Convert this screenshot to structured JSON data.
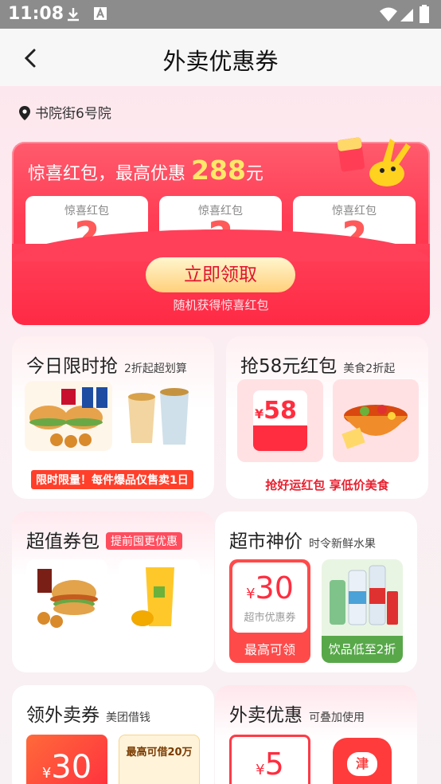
{
  "status_bar": {
    "time": "11:08"
  },
  "header": {
    "title": "外卖优惠券"
  },
  "location": {
    "text": "书院街6号院"
  },
  "red_packet": {
    "prefix": "惊喜红包，最高优惠",
    "amount": "288",
    "unit": "元",
    "cards": [
      {
        "label": "惊喜红包",
        "mark": "?"
      },
      {
        "label": "惊喜红包",
        "mark": "?"
      },
      {
        "label": "惊喜红包",
        "mark": "?"
      }
    ],
    "button": "立即领取",
    "subtext": "随机获得惊喜红包"
  },
  "cards": {
    "flash": {
      "title": "今日限时抢",
      "sub": "2折起超划算",
      "banner": "限时限量！每件爆品仅售卖1日"
    },
    "red58": {
      "title": "抢58元红包",
      "sub": "美食2折起",
      "coupon_symbol": "¥",
      "coupon_value": "58",
      "banner": "抢好运红包 享低价美食"
    },
    "bundle": {
      "title": "超值券包",
      "tag": "提前囤更优惠"
    },
    "market": {
      "title": "超市神价",
      "sub": "时令新鲜水果",
      "coupon_symbol": "¥",
      "coupon_value": "30",
      "coupon_label": "超市优惠券",
      "btn_left": "最高可领",
      "btn_right": "饮品低至2折"
    },
    "takeout_coupon": {
      "title": "领外卖券",
      "sub": "美团借钱",
      "coupon_symbol": "¥",
      "coupon_value": "30",
      "side_text": "最高可借20万"
    },
    "takeout_discount": {
      "title": "外卖优惠",
      "sub": "可叠加使用",
      "coupon_symbol": "¥",
      "coupon_value": "5",
      "box_char": "津"
    }
  },
  "colors": {
    "accent_red": "#ff2c46",
    "gold": "#ffe86a"
  }
}
